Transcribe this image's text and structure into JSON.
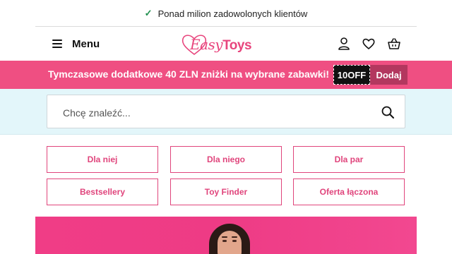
{
  "topbar": {
    "message": "Ponad milion zadowolonych klientów",
    "check_icon": "check-icon"
  },
  "header": {
    "menu_label": "Menu",
    "logo": {
      "part1": "Easy",
      "part2": "Toys"
    },
    "icons": [
      "user-icon",
      "heart-icon",
      "basket-icon"
    ]
  },
  "promo": {
    "text": "Tymczasowe dodatkowe 40 ZLN zniżki na wybrane zabawki!",
    "code": "10OFF",
    "add_label": "Dodaj"
  },
  "search": {
    "placeholder": "Chcę znaleźć...",
    "value": ""
  },
  "categories": [
    {
      "label": "Dla niej"
    },
    {
      "label": "Dla niego"
    },
    {
      "label": "Dla par"
    },
    {
      "label": "Bestsellery"
    },
    {
      "label": "Toy Finder"
    },
    {
      "label": "Oferta łączona"
    }
  ],
  "colors": {
    "brand_pink": "#ef4f82",
    "promo_add": "#b3375f",
    "search_band": "#e3f6fa",
    "check_green": "#1f8f4e"
  }
}
